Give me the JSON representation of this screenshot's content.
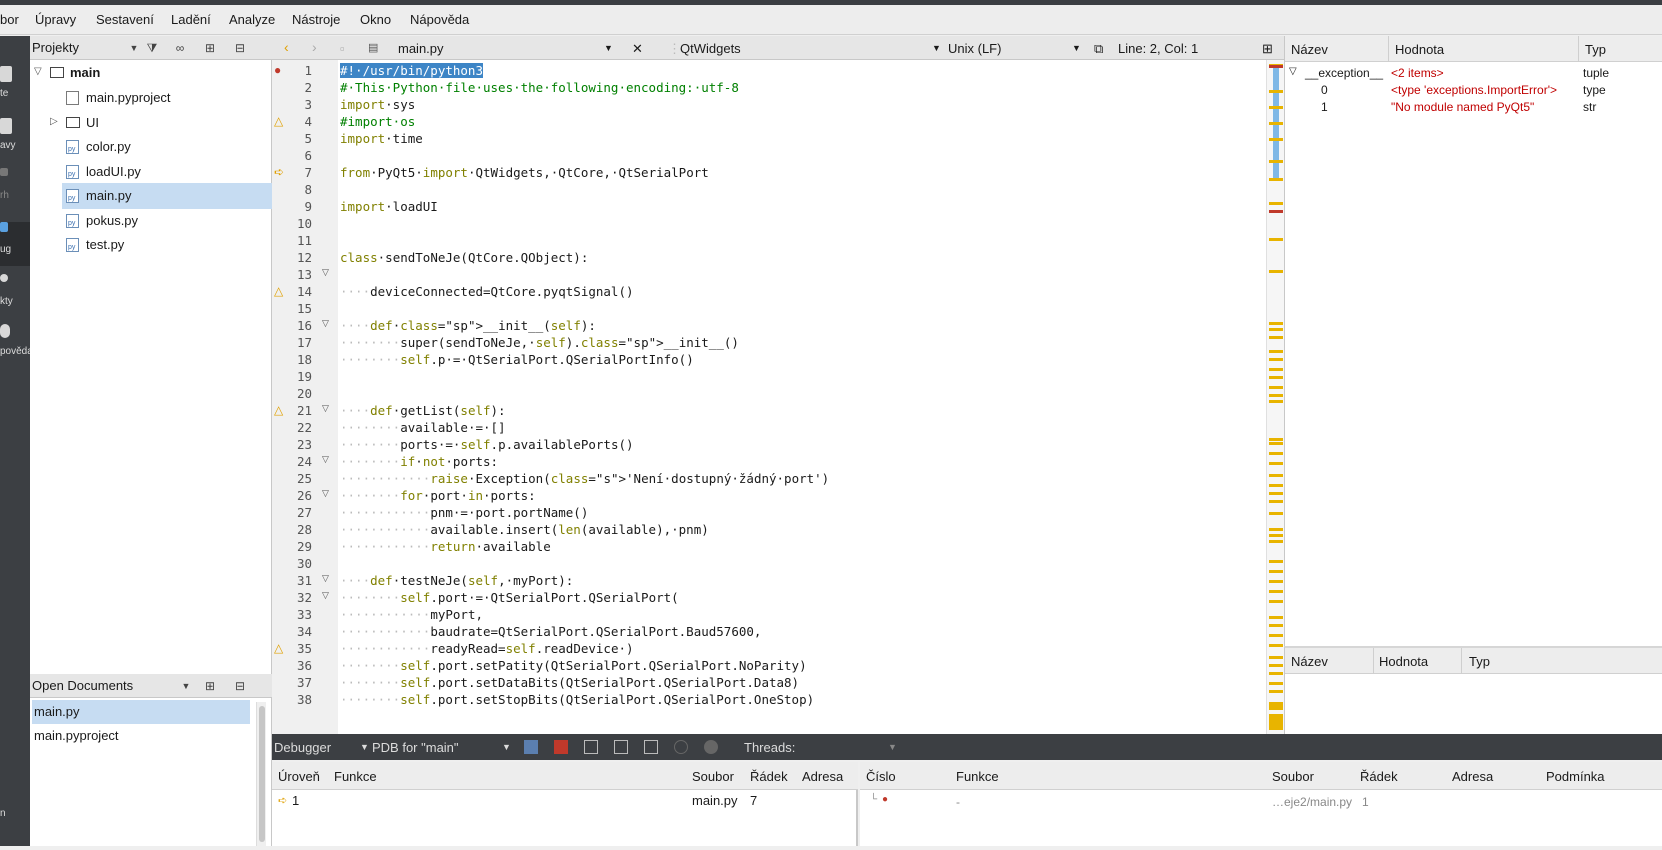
{
  "menu": [
    "bor",
    "Úpravy",
    "Sestavení",
    "Ladění",
    "Analyze",
    "Nástroje",
    "Okno",
    "Nápověda"
  ],
  "modes": [
    "te",
    "avy",
    "rh",
    "ug",
    "kty",
    "pověda",
    "n"
  ],
  "projects": {
    "title": "Projekty",
    "items": [
      {
        "label": "main",
        "type": "root"
      },
      {
        "label": "main.pyproject",
        "type": "file"
      },
      {
        "label": "UI",
        "type": "folder"
      },
      {
        "label": "color.py",
        "type": "py"
      },
      {
        "label": "loadUI.py",
        "type": "py"
      },
      {
        "label": "main.py",
        "type": "py",
        "selected": true
      },
      {
        "label": "pokus.py",
        "type": "py"
      },
      {
        "label": "test.py",
        "type": "py"
      }
    ]
  },
  "open_documents": {
    "title": "Open Documents",
    "items": [
      "main.py",
      "main.pyproject"
    ]
  },
  "editor": {
    "file": "main.py",
    "symbol": "QtWidgets",
    "line_ending": "Unix (LF)",
    "position": "Line: 2, Col: 1",
    "lines": [
      "#!·/usr/bin/python3",
      "#·This·Python·file·uses·the·following·encoding:·utf-8",
      "import·sys",
      "#import·os",
      "import·time",
      "",
      "from·PyQt5·import·QtWidgets,·QtCore,·QtSerialPort",
      "",
      "import·loadUI",
      "",
      "",
      "class·sendToNeJe(QtCore.QObject):",
      "",
      "····deviceConnected=QtCore.pyqtSignal()",
      "",
      "····def·__init__(self):",
      "········super(sendToNeJe,·self).__init__()",
      "········self.p·=·QtSerialPort.QSerialPortInfo()",
      "",
      "",
      "····def·getList(self):",
      "········available·=·[]",
      "········ports·=·self.p.availablePorts()",
      "········if·not·ports:",
      "············raise·Exception('Není·dostupný·žádný·port')",
      "········for·port·in·ports:",
      "············pnm·=·port.portName()",
      "············available.insert(len(available),·pnm)",
      "············return·available",
      "",
      "····def·testNeJe(self,·myPort):",
      "········self.port·=·QtSerialPort.QSerialPort(",
      "············myPort,",
      "············baudrate=QtSerialPort.QSerialPort.Baud57600,",
      "············readyRead=self.readDevice·)",
      "········self.port.setPatity(QtSerialPort.QSerialPort.NoParity)",
      "········self.port.setDataBits(QtSerialPort.QSerialPort.Data8)",
      "········self.port.setStopBits(QtSerialPort.QSerialPort.OneStop)"
    ],
    "warning_lines": [
      4,
      14,
      21,
      35
    ],
    "breakpoint_line": 1,
    "current_line": 7,
    "fold_lines": [
      13,
      16,
      21,
      24,
      26,
      31,
      32
    ]
  },
  "variables": {
    "headers": [
      "Název",
      "Hodnota",
      "Typ"
    ],
    "rows": [
      {
        "name": "__exception__",
        "value": "<2 items>",
        "type": "tuple",
        "indent": 0
      },
      {
        "name": "0",
        "value": "<type 'exceptions.ImportError'>",
        "type": "type",
        "indent": 1
      },
      {
        "name": "1",
        "value": "\"No module named PyQt5\"",
        "type": "str",
        "indent": 1
      }
    ]
  },
  "expressions": {
    "headers": [
      "Název",
      "Hodnota",
      "Typ"
    ]
  },
  "debugger_bar": {
    "view": "Debugger",
    "engine": "PDB for \"main\"",
    "threads_label": "Threads:"
  },
  "stack": {
    "headers": [
      "Úroveň",
      "Funkce",
      "Soubor",
      "Řádek",
      "Adresa"
    ],
    "rows": [
      {
        "level": "1",
        "function": "",
        "file": "main.py",
        "line": "7",
        "address": ""
      }
    ]
  },
  "breakpoints": {
    "headers": [
      "Číslo",
      "Funkce",
      "Soubor",
      "Řádek",
      "Adresa",
      "Podmínka"
    ],
    "rows": [
      {
        "number": "",
        "function": "-",
        "file": "…eje2/main.py",
        "line": "1"
      }
    ]
  }
}
